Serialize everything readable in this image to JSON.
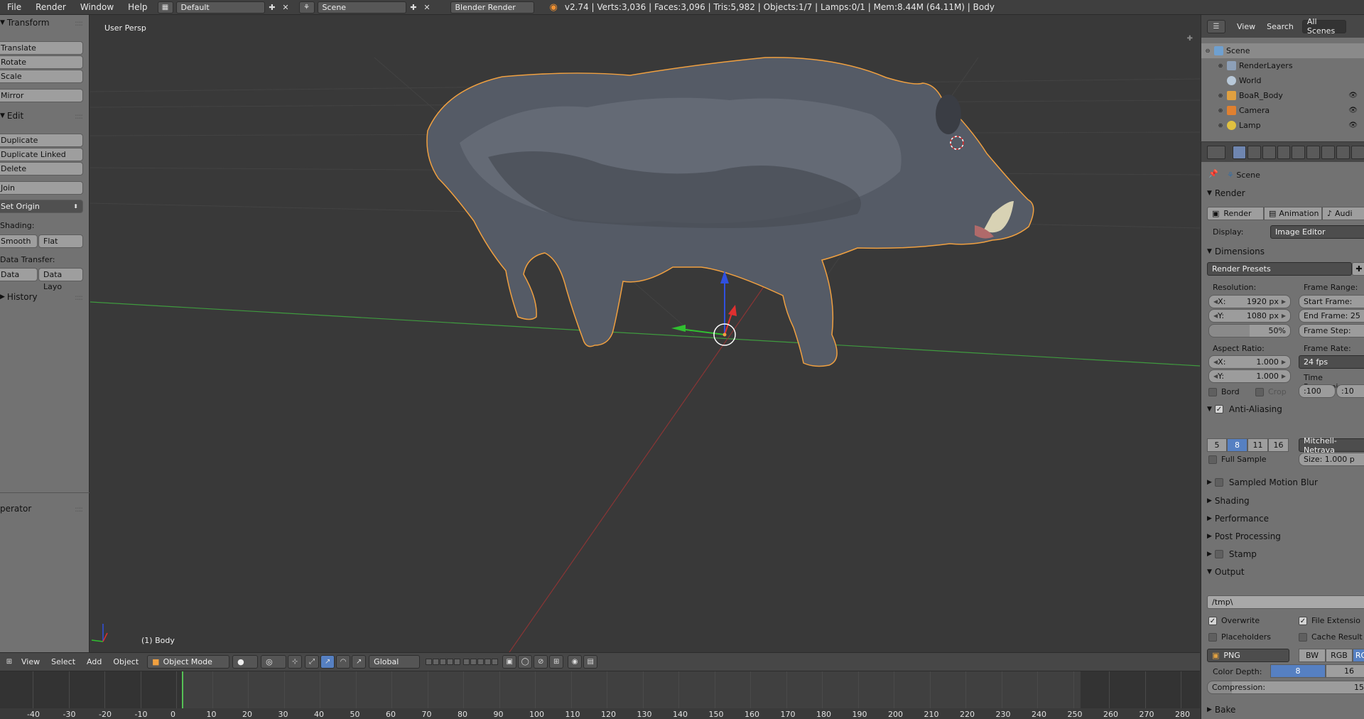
{
  "topbar": {
    "menus": [
      "File",
      "Render",
      "Window",
      "Help"
    ],
    "layout": "Default",
    "scene": "Scene",
    "engine": "Blender Render",
    "stats": "v2.74 | Verts:3,036 | Faces:3,096 | Tris:5,982 | Objects:1/7 | Lamps:0/1 | Mem:8.44M (64.11M) | Body"
  },
  "toolshelf": {
    "transform_header": "Transform",
    "translate": "Translate",
    "rotate": "Rotate",
    "scale": "Scale",
    "mirror": "Mirror",
    "edit_header": "Edit",
    "duplicate": "Duplicate",
    "duplicate_linked": "Duplicate Linked",
    "delete": "Delete",
    "join": "Join",
    "set_origin": "Set Origin",
    "shading_label": "Shading:",
    "smooth": "Smooth",
    "flat": "Flat",
    "data_transfer_label": "Data Transfer:",
    "data": "Data",
    "data_layout": "Data Layo",
    "history_header": "History",
    "operator_header": "perator"
  },
  "viewport": {
    "view_label": "User Persp",
    "object_label": "(1) Body"
  },
  "view3d_header": {
    "menus": [
      "View",
      "Select",
      "Add",
      "Object"
    ],
    "mode": "Object Mode",
    "orientation": "Global"
  },
  "timeline": {
    "ticks": [
      "-40",
      "-30",
      "-20",
      "-10",
      "0",
      "10",
      "20",
      "30",
      "40",
      "50",
      "60",
      "70",
      "80",
      "90",
      "100",
      "110",
      "120",
      "130",
      "140",
      "150",
      "160",
      "170",
      "180",
      "190",
      "200",
      "210",
      "220",
      "230",
      "240",
      "250",
      "260",
      "270",
      "280"
    ],
    "current_frame": "0"
  },
  "outliner": {
    "view": "View",
    "search": "Search",
    "filter": "All Scenes",
    "items": [
      {
        "label": "Scene"
      },
      {
        "label": "RenderLayers"
      },
      {
        "label": "World"
      },
      {
        "label": "BoaR_Body"
      },
      {
        "label": "Camera"
      },
      {
        "label": "Lamp"
      }
    ]
  },
  "properties": {
    "context": "Scene",
    "render_panel": "Render",
    "render_btn": "Render",
    "animation_btn": "Animation",
    "audio_btn": "Audi",
    "display_label": "Display:",
    "display_value": "Image Editor",
    "dimensions_panel": "Dimensions",
    "render_presets": "Render Presets",
    "resolution_label": "Resolution:",
    "res_x": "X:",
    "res_x_val": "1920 px",
    "res_y": "Y:",
    "res_y_val": "1080 px",
    "res_pct": "50%",
    "frame_range_label": "Frame Range:",
    "start_frame": "Start Frame:",
    "end_frame": "End Frame: 25",
    "frame_step": "Frame Step:",
    "aspect_label": "Aspect Ratio:",
    "asp_x": "X:",
    "asp_x_val": "1.000",
    "asp_y": "Y:",
    "asp_y_val": "1.000",
    "frame_rate_label": "Frame Rate:",
    "frame_rate": "24 fps",
    "time_remap_label": "Time Remapping",
    "remap_old": ":100",
    "remap_new": ":10",
    "bord": "Bord",
    "crop": "Crop",
    "aa_panel": "Anti-Aliasing",
    "aa_samples": [
      "5",
      "8",
      "11",
      "16"
    ],
    "aa_filter": "Mitchell-Netrava",
    "full_sample": "Full Sample",
    "filter_size": "Size:  1.000 p",
    "smb_panel": "Sampled Motion Blur",
    "shading_panel": "Shading",
    "performance_panel": "Performance",
    "post_panel": "Post Processing",
    "stamp_panel": "Stamp",
    "output_panel": "Output",
    "output_path": "/tmp\\",
    "overwrite": "Overwrite",
    "file_ext": "File Extensio",
    "placeholders": "Placeholders",
    "cache_result": "Cache Result",
    "format": "PNG",
    "bw": "BW",
    "rgb": "RGB",
    "rgba": "RG",
    "color_depth_label": "Color Depth:",
    "depth_8": "8",
    "depth_16": "16",
    "compression": "Compression:",
    "compression_val": "15",
    "bake_panel": "Bake"
  },
  "colors": {
    "accent": "#5680c2",
    "x_axis": "#b04040",
    "y_axis": "#3aa03a",
    "selection": "#f0a040"
  }
}
